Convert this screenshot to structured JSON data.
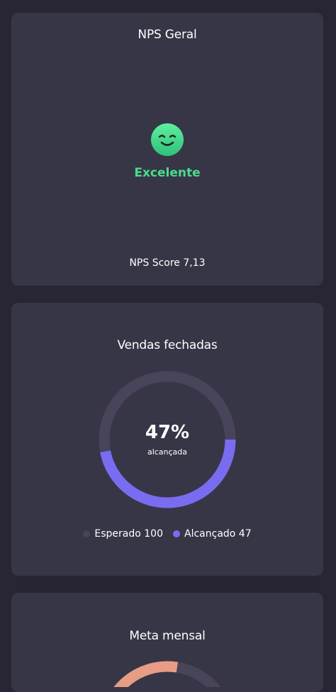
{
  "nps_card": {
    "title": "NPS Geral",
    "face_icon": "smiling-face-icon",
    "status": "Excelente",
    "status_color": "#4bdb8c",
    "score_label": "NPS Score 7,13"
  },
  "sales_card": {
    "title": "Vendas fechadas",
    "percent_text": "47%",
    "percent_label": "alcançada",
    "achieved_fraction": 0.47,
    "track_color": "#48445a",
    "progress_color": "#7a6cf0",
    "legend": [
      {
        "label": "Esperado 100",
        "color": "#48445a"
      },
      {
        "label": "Alcançado 47",
        "color": "#7a6cf0"
      }
    ]
  },
  "meta_card": {
    "title": "Meta mensal",
    "progress_color": "#e79c84",
    "track_color": "#48445a"
  }
}
